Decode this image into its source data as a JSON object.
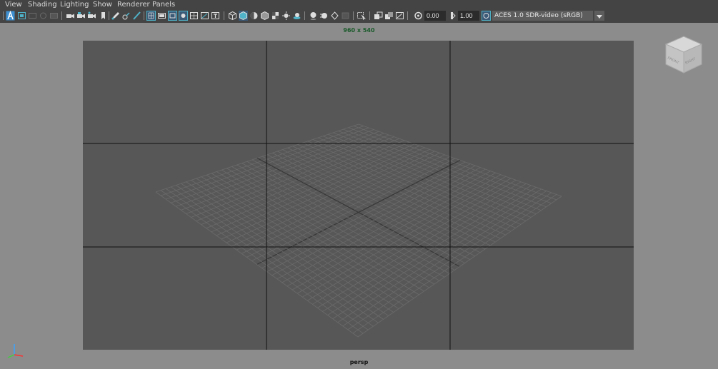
{
  "menu": {
    "view": "View",
    "shading": "Shading",
    "lighting": "Lighting",
    "show": "Show",
    "renderer": "Renderer",
    "panels": "Panels"
  },
  "toolbar": {
    "exposure_value": "0.00",
    "gamma_value": "1.00",
    "color_management": "ACES 1.0 SDR-video (sRGB)"
  },
  "viewport": {
    "resolution_label": "960 x 540",
    "camera_label": "persp",
    "viewcube_front": "FRONT",
    "viewcube_right": "RIGHT"
  },
  "colors": {
    "accent": "#4fb3c9",
    "background": "#8c8c8c",
    "gate": "#575757"
  }
}
